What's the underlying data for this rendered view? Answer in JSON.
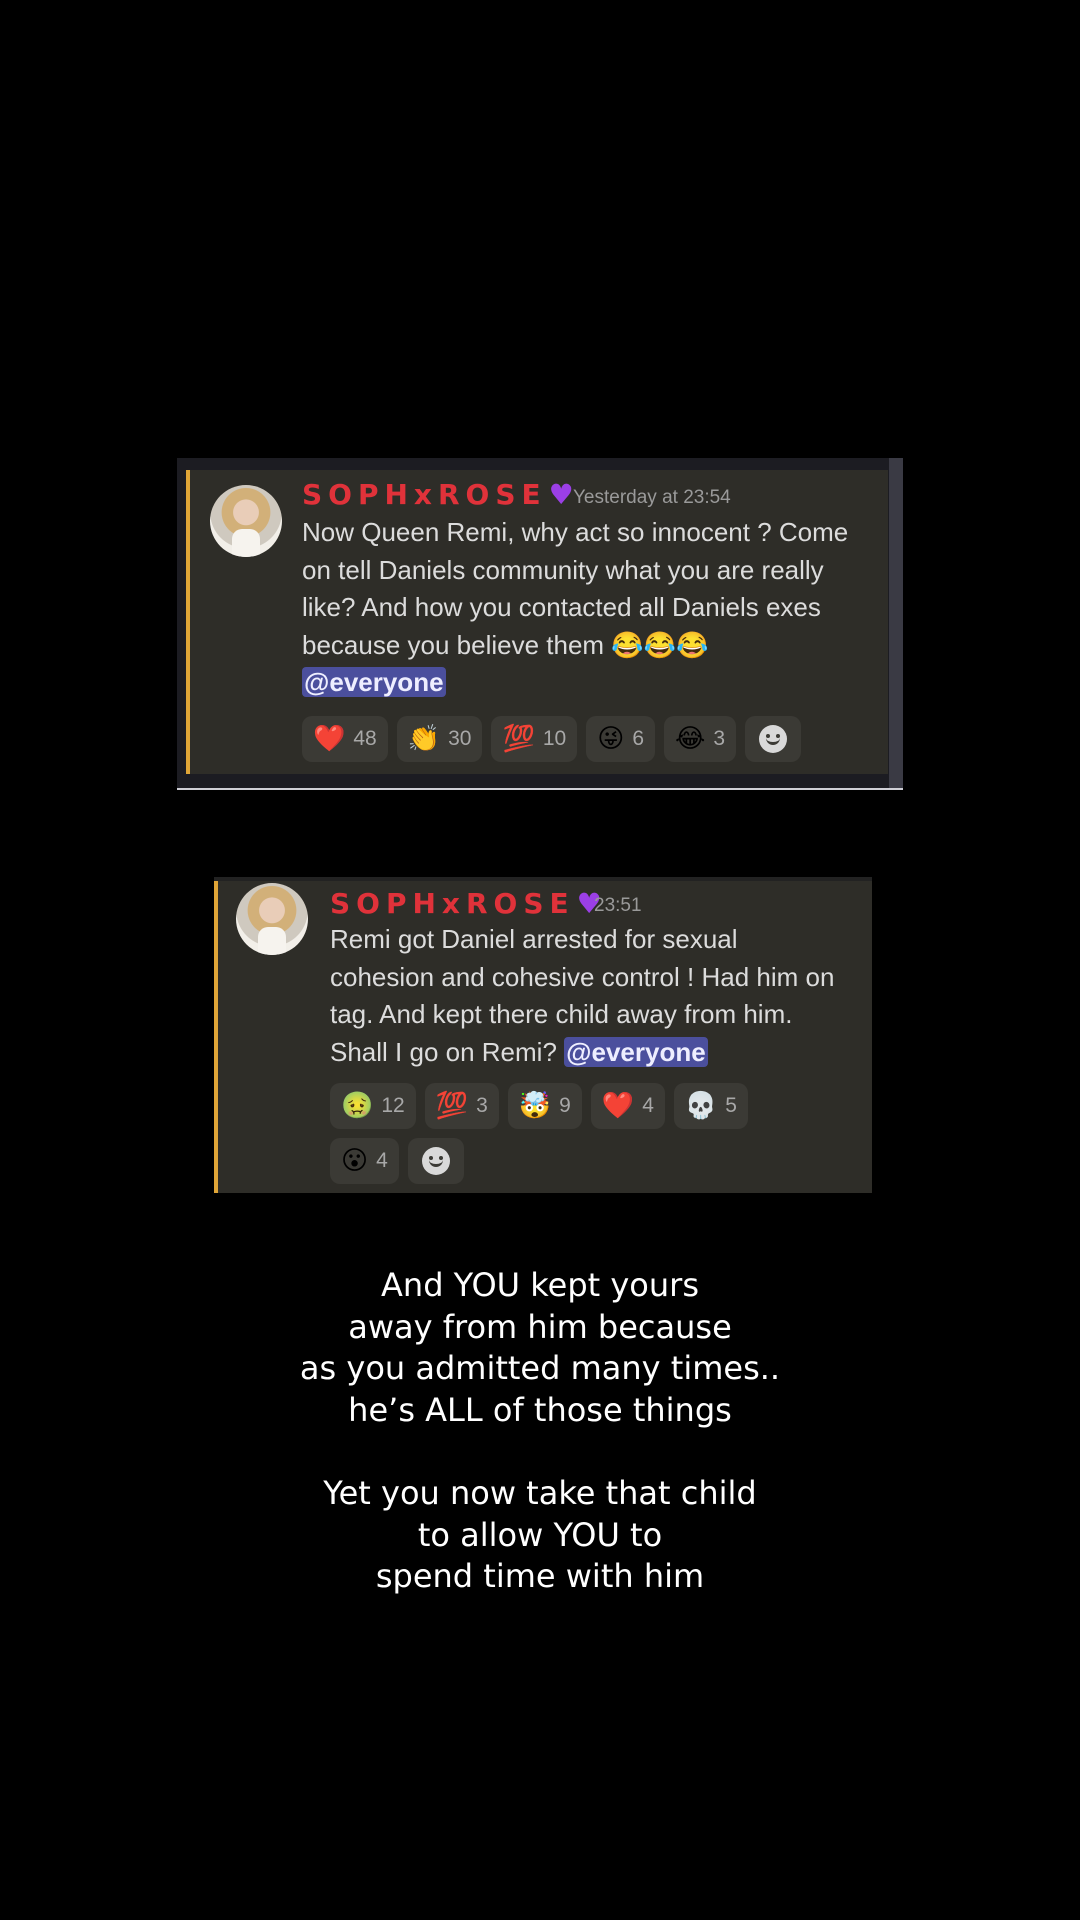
{
  "posts": [
    {
      "username": "SOPHxROSE",
      "username_icon": "purple-heart-icon",
      "timestamp": "Yesterday at 23:54",
      "message_lines": [
        "Now Queen Remi, why act so innocent ? Come",
        "on tell Daniels community what you are really",
        "like? And how you contacted all Daniels exes",
        "because you believe them 😂😂😂"
      ],
      "mention": "@everyone",
      "reactions": [
        {
          "emoji": "❤️",
          "name": "red-heart",
          "count": "48"
        },
        {
          "emoji": "👏",
          "name": "clapping-hands",
          "count": "30"
        },
        {
          "emoji": "💯",
          "name": "hundred-points",
          "count": "10"
        },
        {
          "emoji": "😜",
          "name": "winking-tongue",
          "count": "6"
        },
        {
          "emoji": "😂",
          "name": "tears-of-joy",
          "count": "3"
        }
      ]
    },
    {
      "username": "SOPHxROSE",
      "username_icon": "purple-heart-icon",
      "timestamp": "23:51",
      "message_lines": [
        "Remi got Daniel arrested for sexual",
        "cohesion and cohesive control ! Had him on",
        "tag. And kept there child away from him.",
        "Shall I go on Remi?"
      ],
      "mention": "@everyone",
      "reactions": [
        {
          "emoji": "🤢",
          "name": "nauseated-face",
          "count": "12"
        },
        {
          "emoji": "💯",
          "name": "hundred-points",
          "count": "3"
        },
        {
          "emoji": "🤯",
          "name": "exploding-head",
          "count": "9"
        },
        {
          "emoji": "❤️",
          "name": "red-heart",
          "count": "4"
        },
        {
          "emoji": "💀",
          "name": "skull",
          "count": "5"
        },
        {
          "emoji": "😮",
          "name": "surprised-face",
          "count": "4"
        }
      ]
    }
  ],
  "caption_lines": [
    "And YOU kept yours",
    "away from him because",
    "as you admitted many times..",
    "he’s ALL of those things",
    "",
    "Yet you now take that child",
    "to allow YOU to",
    "spend time with him"
  ],
  "colors": {
    "username": "#e0323a",
    "accent_bar": "#e0a537",
    "mention_bg": "#4b4f9d",
    "card_bg": "#2e2d28"
  }
}
